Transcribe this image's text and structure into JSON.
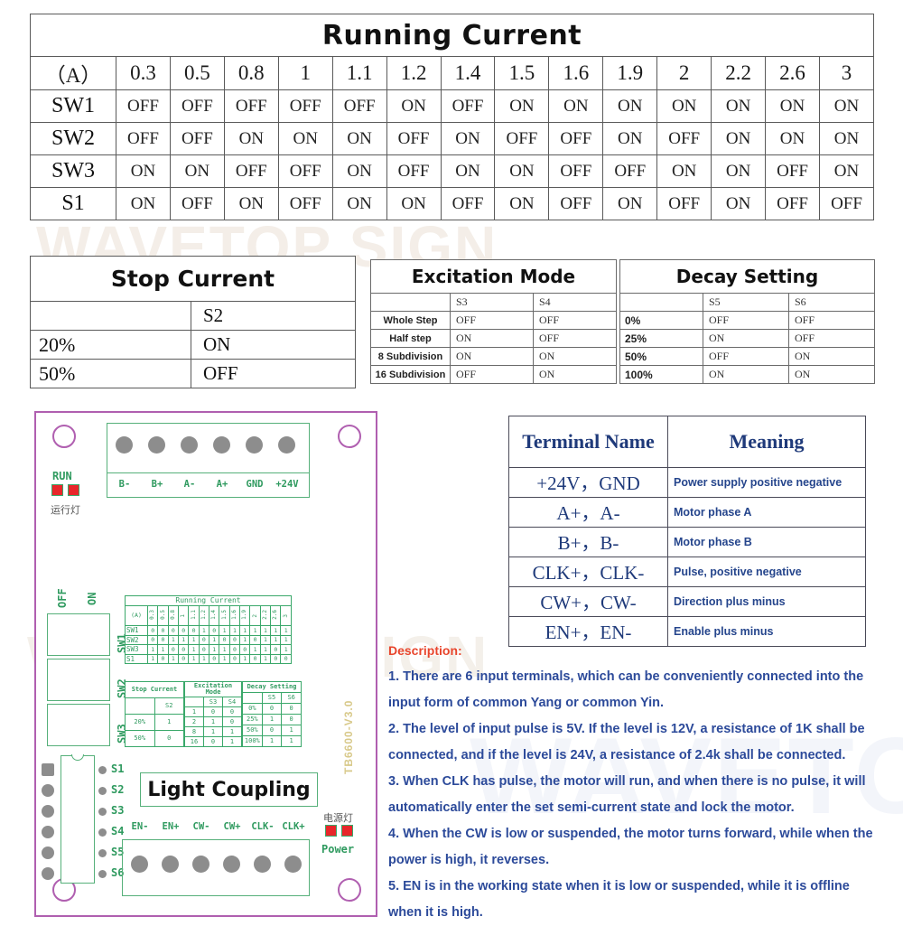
{
  "running_current": {
    "title": "Running Current",
    "header": [
      "（A）",
      "0.3",
      "0.5",
      "0.8",
      "1",
      "1.1",
      "1.2",
      "1.4",
      "1.5",
      "1.6",
      "1.9",
      "2",
      "2.2",
      "2.6",
      "3"
    ],
    "rows": [
      {
        "label": "SW1",
        "values": [
          "OFF",
          "OFF",
          "OFF",
          "OFF",
          "OFF",
          "ON",
          "OFF",
          "ON",
          "ON",
          "ON",
          "ON",
          "ON",
          "ON",
          "ON"
        ]
      },
      {
        "label": "SW2",
        "values": [
          "OFF",
          "OFF",
          "ON",
          "ON",
          "ON",
          "OFF",
          "ON",
          "OFF",
          "OFF",
          "ON",
          "OFF",
          "ON",
          "ON",
          "ON"
        ]
      },
      {
        "label": "SW3",
        "values": [
          "ON",
          "ON",
          "OFF",
          "OFF",
          "ON",
          "OFF",
          "ON",
          "ON",
          "OFF",
          "OFF",
          "ON",
          "ON",
          "OFF",
          "ON"
        ]
      },
      {
        "label": "S1",
        "values": [
          "ON",
          "OFF",
          "ON",
          "OFF",
          "ON",
          "ON",
          "OFF",
          "ON",
          "OFF",
          "ON",
          "OFF",
          "ON",
          "OFF",
          "OFF"
        ]
      }
    ]
  },
  "stop_current": {
    "title": "Stop Current",
    "col_header": "S2",
    "rows": [
      {
        "label": "20%",
        "value": "ON"
      },
      {
        "label": "50%",
        "value": "OFF"
      }
    ]
  },
  "excitation_mode": {
    "title": "Excitation Mode",
    "col_headers": [
      "S3",
      "S4"
    ],
    "rows": [
      {
        "label": "Whole Step",
        "values": [
          "OFF",
          "OFF"
        ]
      },
      {
        "label": "Half step",
        "values": [
          "ON",
          "OFF"
        ]
      },
      {
        "label": "8 Subdivision",
        "values": [
          "ON",
          "ON"
        ]
      },
      {
        "label": "16 Subdivision",
        "values": [
          "OFF",
          "ON"
        ]
      }
    ]
  },
  "decay_setting": {
    "title": "Decay Setting",
    "col_headers": [
      "S5",
      "S6"
    ],
    "rows": [
      {
        "label": "0%",
        "values": [
          "OFF",
          "OFF"
        ]
      },
      {
        "label": "25%",
        "values": [
          "ON",
          "OFF"
        ]
      },
      {
        "label": "50%",
        "values": [
          "OFF",
          "ON"
        ]
      },
      {
        "label": "100%",
        "values": [
          "ON",
          "ON"
        ]
      }
    ]
  },
  "terminal_table": {
    "headers": [
      "Terminal Name",
      "Meaning"
    ],
    "rows": [
      {
        "name": "+24V，GND",
        "meaning": "Power supply positive negative"
      },
      {
        "name": "A+，A-",
        "meaning": "Motor phase A"
      },
      {
        "name": "B+，B-",
        "meaning": "Motor phase B"
      },
      {
        "name": "CLK+，CLK-",
        "meaning": "Pulse, positive negative"
      },
      {
        "name": "CW+，CW-",
        "meaning": "Direction plus minus"
      },
      {
        "name": "EN+，EN-",
        "meaning": "Enable plus minus"
      }
    ]
  },
  "description": {
    "title": "Description:",
    "items": [
      "1. There are 6 input terminals, which can be conveniently connected into the input form of common Yang or common Yin.",
      "2. The level of input pulse is 5V. If the level is 12V, a resistance of 1K shall be connected, and if the level is 24V, a resistance of 2.4k shall be connected.",
      "3. When CLK has pulse, the motor will run, and when there is no pulse, it will automatically enter the set semi-current state and lock the motor.",
      "4. When the CW is low or suspended, the motor turns forward, while when the power is high, it reverses.",
      "5. EN is in the working state when it is low or suspended, while it is offline when it is high."
    ]
  },
  "pcb": {
    "version": "TB6600-V3.0",
    "run_led": {
      "label": "RUN",
      "sub_label": "运行灯"
    },
    "power_led": {
      "label": "Power",
      "sub_label": "电源灯"
    },
    "top_terminals": [
      "B-",
      "B+",
      "A-",
      "A+",
      "GND",
      "+24V"
    ],
    "bottom_terminals": [
      "EN-",
      "EN+",
      "CW-",
      "CW+",
      "CLK-",
      "CLK+"
    ],
    "dip_off_label": "OFF",
    "dip_on_label": "ON",
    "dip_switches": [
      "SW1",
      "SW2",
      "SW3"
    ],
    "ic_pins": [
      "S1",
      "S2",
      "S3",
      "S4",
      "S5",
      "S6"
    ],
    "light_coupling": "Light Coupling",
    "silk": {
      "running_title": "Running Current",
      "header": [
        "(A)",
        "0.3",
        "0.5",
        "0.8",
        "1",
        "1.1",
        "1.2",
        "1.4",
        "1.5",
        "1.6",
        "1.9",
        "2",
        "2.2",
        "2.6",
        "3"
      ],
      "rows": [
        {
          "label": "SW1",
          "values": [
            "0",
            "0",
            "0",
            "0",
            "0",
            "1",
            "0",
            "1",
            "1",
            "1",
            "1",
            "1",
            "1",
            "1"
          ]
        },
        {
          "label": "SW2",
          "values": [
            "0",
            "0",
            "1",
            "1",
            "1",
            "0",
            "1",
            "0",
            "0",
            "1",
            "0",
            "1",
            "1",
            "1"
          ]
        },
        {
          "label": "SW3",
          "values": [
            "1",
            "1",
            "0",
            "0",
            "1",
            "0",
            "1",
            "1",
            "0",
            "0",
            "1",
            "1",
            "0",
            "1"
          ]
        },
        {
          "label": "S1",
          "values": [
            "1",
            "0",
            "1",
            "0",
            "1",
            "1",
            "0",
            "1",
            "0",
            "1",
            "0",
            "1",
            "0",
            "0"
          ]
        }
      ],
      "stop_title": "Stop Current",
      "stop_head": "S2",
      "stop_rows": [
        {
          "label": "20%",
          "value": "1"
        },
        {
          "label": "50%",
          "value": "0"
        }
      ],
      "exc_title": "Excitation Mode",
      "exc_head": [
        "S3",
        "S4"
      ],
      "exc_rows": [
        {
          "label": "1",
          "values": [
            "0",
            "0"
          ]
        },
        {
          "label": "2",
          "values": [
            "1",
            "0"
          ]
        },
        {
          "label": "8",
          "values": [
            "1",
            "1"
          ]
        },
        {
          "label": "16",
          "values": [
            "0",
            "1"
          ]
        }
      ],
      "decay_title": "Decay Setting",
      "decay_head": [
        "S5",
        "S6"
      ],
      "decay_rows": [
        {
          "label": "0%",
          "values": [
            "0",
            "0"
          ]
        },
        {
          "label": "25%",
          "values": [
            "1",
            "0"
          ]
        },
        {
          "label": "50%",
          "values": [
            "0",
            "1"
          ]
        },
        {
          "label": "100%",
          "values": [
            "1",
            "1"
          ]
        }
      ]
    }
  },
  "watermark": {
    "line1": "WAVETOP SIGN",
    "line2": "WAVETOP SIGN",
    "line3": "WAVETOP"
  },
  "colors": {
    "pcb_edge": "#b05fb0",
    "silk_green": "#2f9a5f",
    "led_red": "#e8262a",
    "terminal_blue": "#1f3a7a",
    "desc_blue": "#2c4a9a",
    "desc_title_red": "#e8452c"
  }
}
